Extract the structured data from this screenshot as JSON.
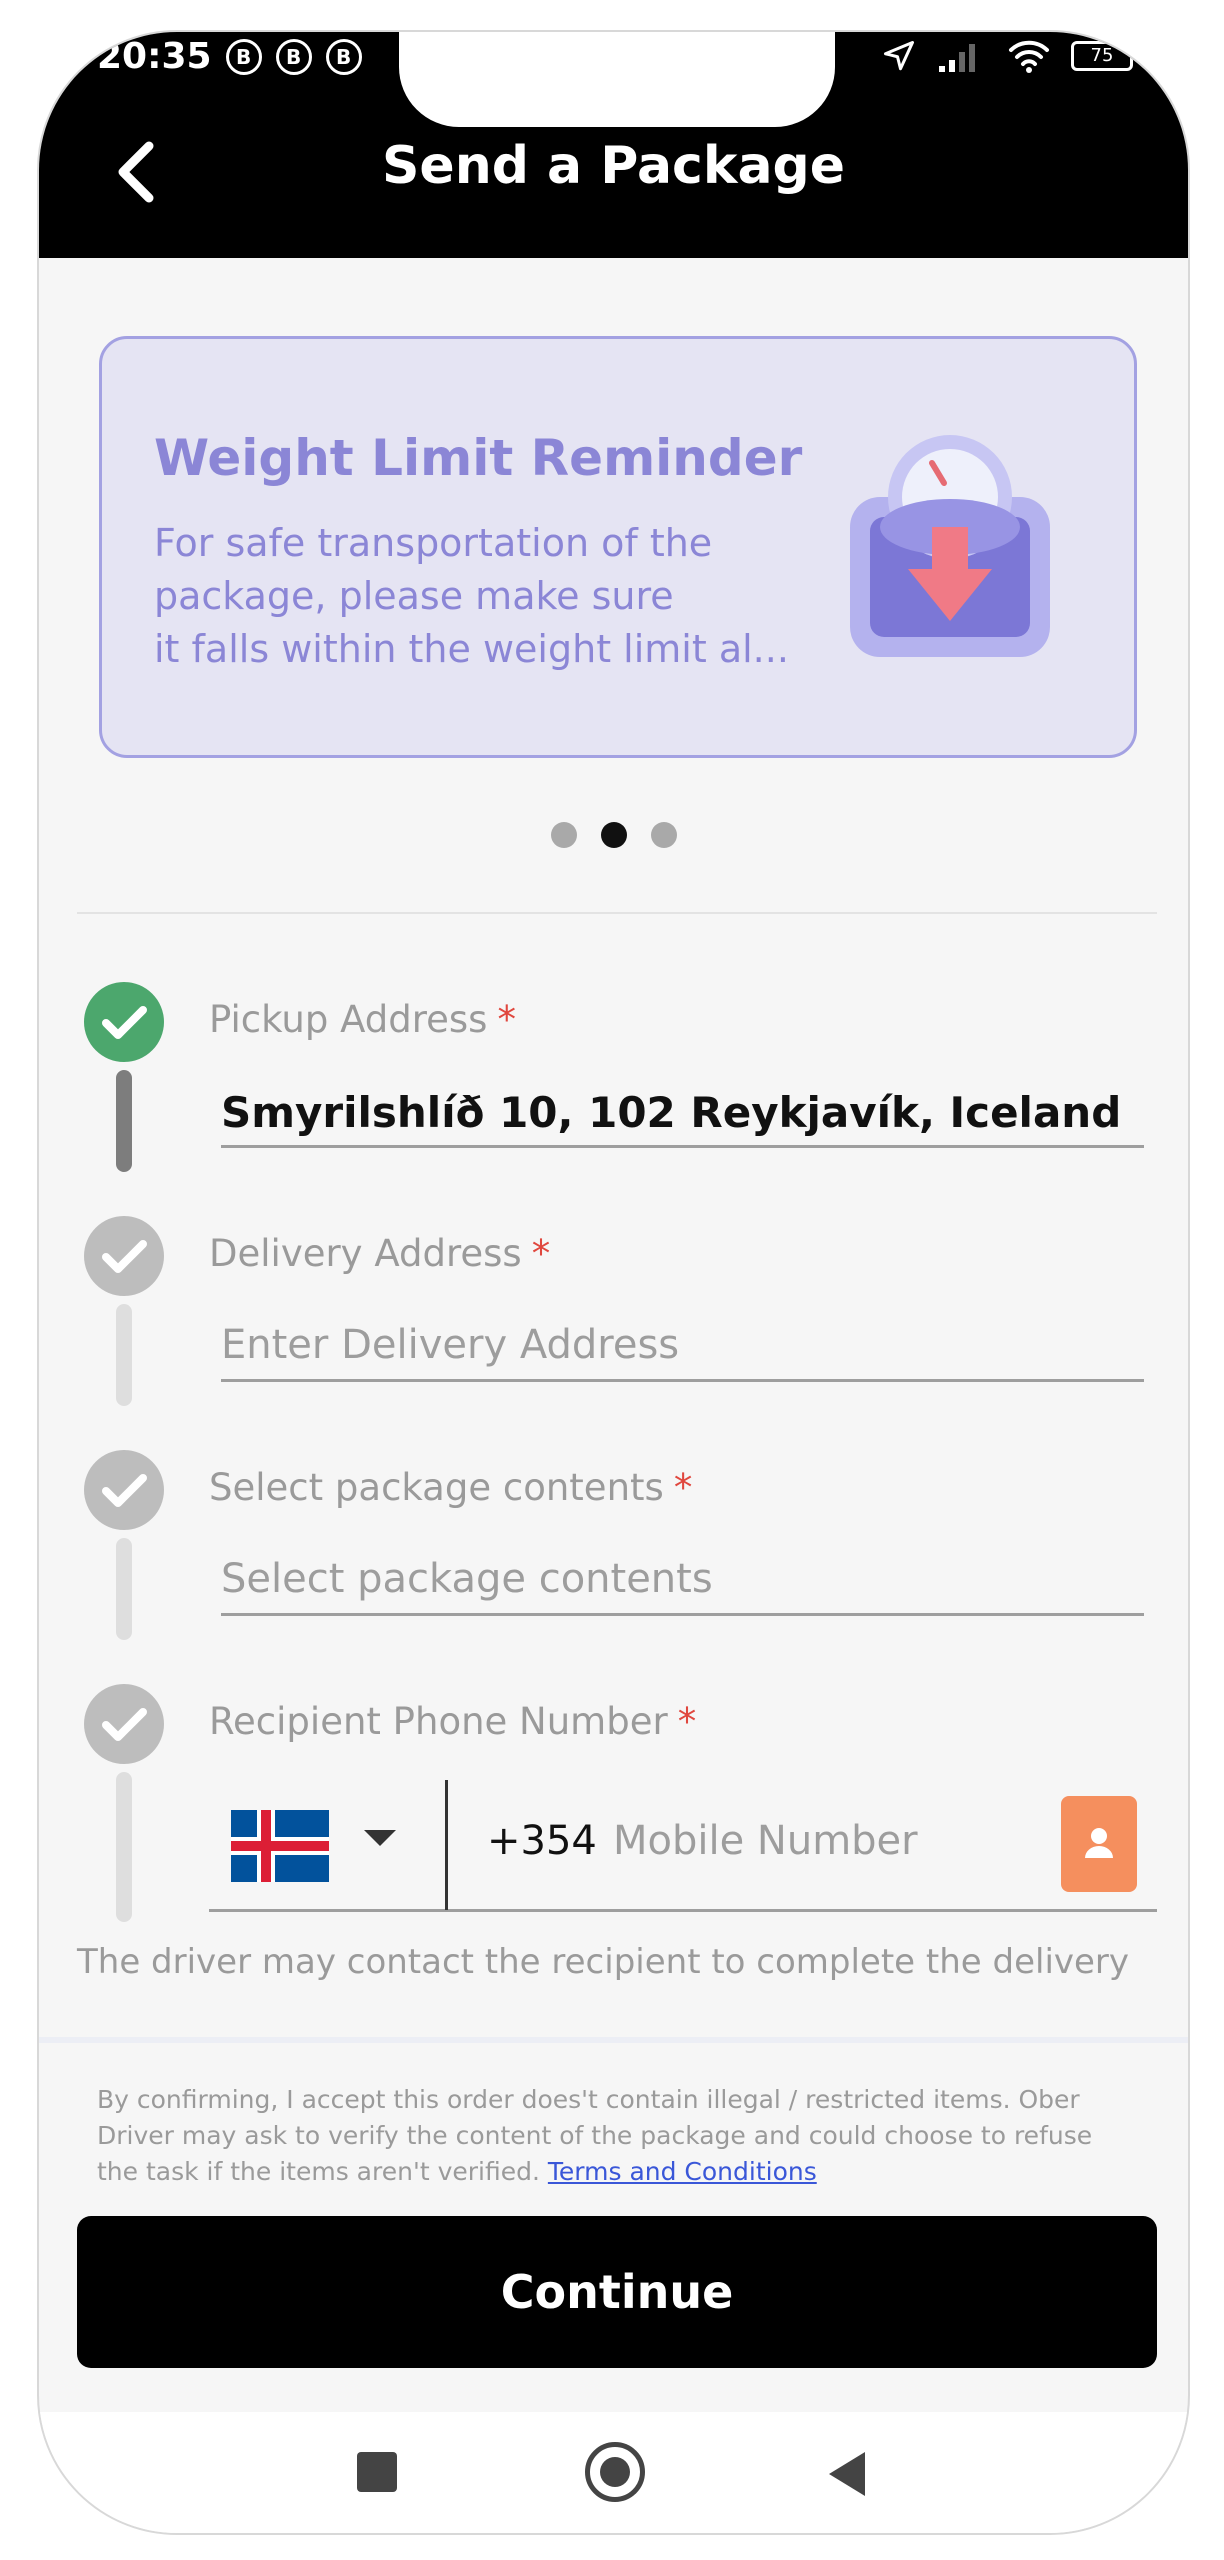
{
  "status_bar": {
    "time": "20:35",
    "notif_icons": [
      "B",
      "B",
      "B"
    ],
    "battery": "75"
  },
  "header": {
    "title": "Send a Package"
  },
  "banner": {
    "title": "Weight Limit Reminder",
    "lines": [
      "For safe transportation of the",
      "package, please make sure",
      "it falls within the weight limit al..."
    ]
  },
  "carousel": {
    "count": 3,
    "active_index": 1
  },
  "form": {
    "pickup": {
      "label": "Pickup Address",
      "required_mark": "*",
      "value": "Smyrilshlíð 10, 102 Reykjavík, Iceland"
    },
    "delivery": {
      "label": "Delivery Address",
      "required_mark": "*",
      "placeholder": "Enter Delivery Address"
    },
    "contents": {
      "label": "Select package contents",
      "required_mark": "*",
      "placeholder": "Select package contents"
    },
    "recipient_phone": {
      "label": "Recipient Phone Number",
      "required_mark": "*",
      "country_code": "+354",
      "placeholder": "Mobile Number"
    },
    "hint": "The driver may contact the recipient to complete the delivery"
  },
  "footer": {
    "disclaimer": "By confirming, I accept this order does't contain illegal / restricted items. Ober Driver may ask to verify the content of the package and could choose to refuse the task if the items aren't verified.",
    "terms_link": "Terms and Conditions",
    "continue_label": "Continue"
  },
  "colors": {
    "header_bg": "#000000",
    "banner_accent": "#8b86d6",
    "check_done": "#4ca76d",
    "check_pending": "#bdbdbd",
    "required": "#e0473e",
    "contact_btn": "#f58f5e",
    "link": "#3a57d8"
  }
}
